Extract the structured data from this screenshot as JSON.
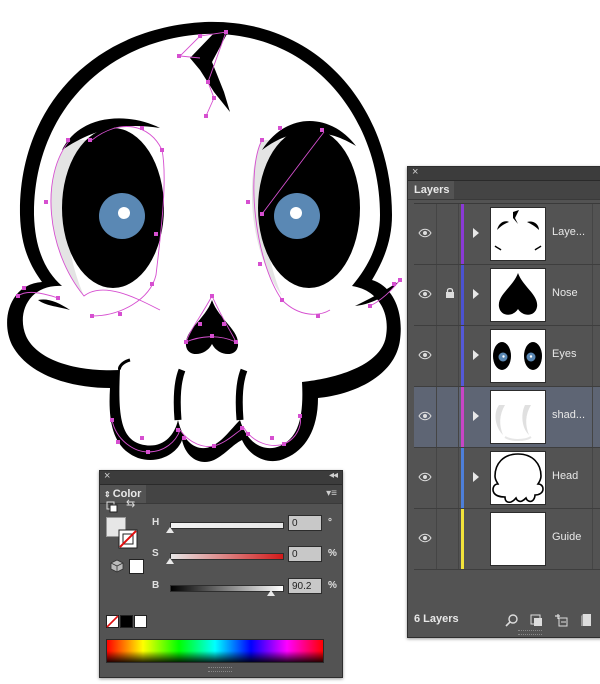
{
  "artwork": {
    "outline_color": "#000000",
    "fill_color": "#ffffff",
    "shade_color": "#e4e4e4",
    "iris_color": "#5a88b4",
    "path_color": "#d64fd0"
  },
  "color_panel": {
    "tab_label": "Color",
    "model": "HSB",
    "sliders": [
      {
        "label": "H",
        "value": "0",
        "unit": "°",
        "fraction": 0.0
      },
      {
        "label": "S",
        "value": "0",
        "unit": "%",
        "fraction": 0.0
      },
      {
        "label": "B",
        "value": "90.2",
        "unit": "%",
        "fraction": 0.902
      }
    ],
    "fill_swatch": "#e6e6e6",
    "stroke": "none",
    "icons": [
      "close-icon",
      "collapse-icon",
      "panel-menu-icon",
      "swap-fill-stroke-icon",
      "default-fill-stroke-icon",
      "out-of-gamut-cube-icon",
      "none-swatch-icon",
      "black-swatch-icon",
      "white-swatch-icon",
      "color-spectrum"
    ]
  },
  "layers_panel": {
    "tab_label": "Layers",
    "layers": [
      {
        "name": "Laye...",
        "color": "#8a39d6",
        "locked": false,
        "selected": false,
        "thumb": "layer1"
      },
      {
        "name": "Nose",
        "color": "#4b52d1",
        "locked": true,
        "selected": false,
        "thumb": "nose"
      },
      {
        "name": "Eyes",
        "color": "#5459d8",
        "locked": false,
        "selected": false,
        "thumb": "eyes"
      },
      {
        "name": "shad...",
        "color": "#c845c6",
        "locked": false,
        "selected": true,
        "thumb": "shadow"
      },
      {
        "name": "Head",
        "color": "#4d7fd9",
        "locked": false,
        "selected": false,
        "thumb": "head"
      },
      {
        "name": "Guide",
        "color": "#f2e33a",
        "locked": false,
        "selected": false,
        "thumb": "guide"
      }
    ],
    "footer_label": "6 Layers",
    "footer_icons": [
      "locate-object-icon",
      "make-clipping-mask-icon",
      "create-sublayer-icon",
      "new-layer-icon"
    ]
  }
}
